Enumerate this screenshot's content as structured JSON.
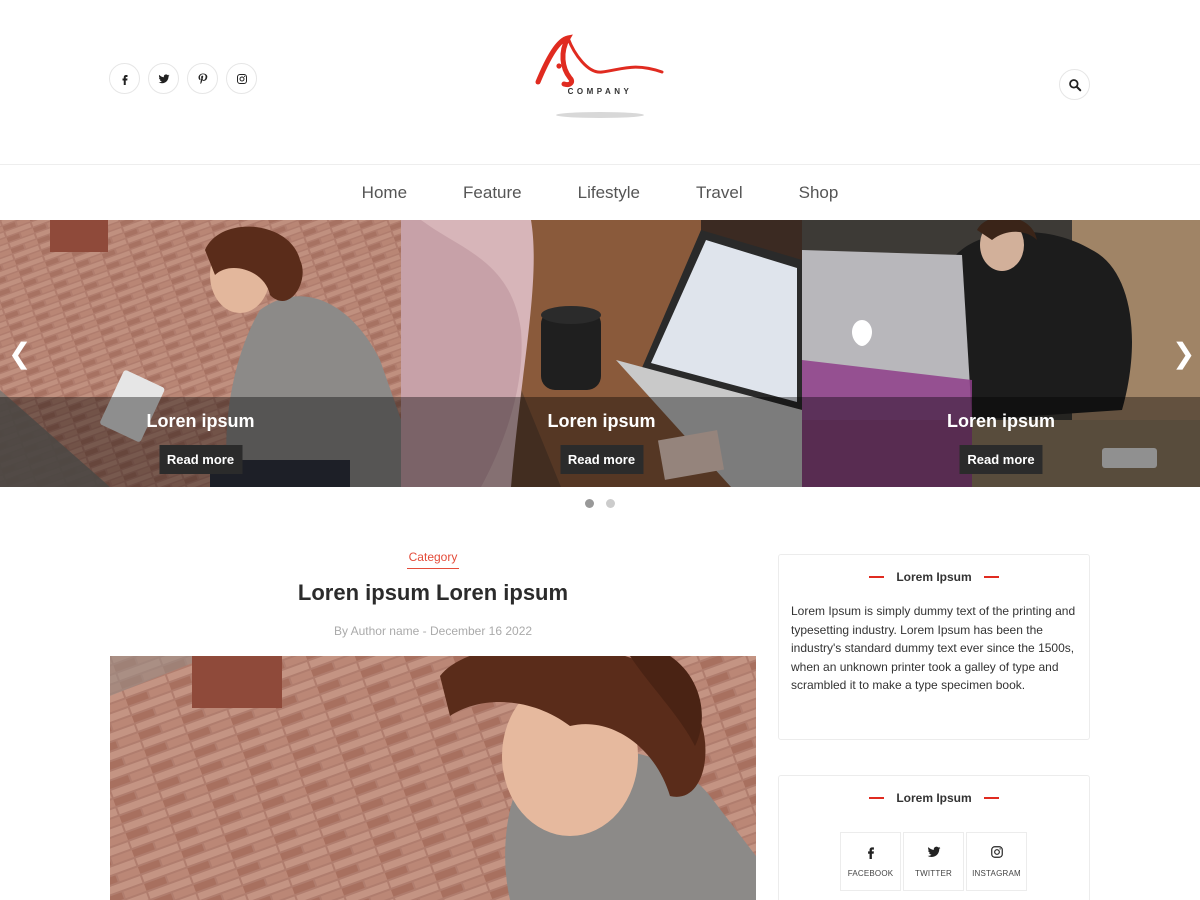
{
  "header": {
    "social_icons": [
      "facebook-icon",
      "twitter-icon",
      "pinterest-icon",
      "instagram-icon"
    ],
    "logo_text": "COMPANY",
    "search_icon": "search-icon"
  },
  "nav": {
    "items": [
      {
        "label": "Home"
      },
      {
        "label": "Feature"
      },
      {
        "label": "Lifestyle"
      },
      {
        "label": "Travel"
      },
      {
        "label": "Shop"
      }
    ]
  },
  "slider": {
    "prev_arrow": "❮",
    "next_arrow": "❯",
    "slides": [
      {
        "title": "Loren ipsum",
        "button": "Read more"
      },
      {
        "title": "Loren ipsum",
        "button": "Read more"
      },
      {
        "title": "Loren ipsum",
        "button": "Read more"
      }
    ],
    "active_dot": 1,
    "dot_count": 2
  },
  "post": {
    "category": "Category",
    "title": "Loren ipsum Loren ipsum",
    "meta": "By Author name - December 16 2022"
  },
  "sidebar": {
    "about": {
      "title": "Lorem Ipsum",
      "text": "Lorem Ipsum is simply dummy text of the printing and typesetting industry. Lorem Ipsum has been the industry's standard dummy text ever since the 1500s, when an unknown printer took a galley of type and scrambled it to make a type specimen book."
    },
    "social": {
      "title": "Lorem Ipsum",
      "items": [
        {
          "icon": "facebook-icon",
          "label": "FACEBOOK"
        },
        {
          "icon": "twitter-icon",
          "label": "TWITTER"
        },
        {
          "icon": "instagram-icon",
          "label": "INSTAGRAM"
        }
      ]
    }
  },
  "colors": {
    "accent": "#e02b20",
    "category": "#e44c3a",
    "button_dark": "#2b2b2b"
  }
}
